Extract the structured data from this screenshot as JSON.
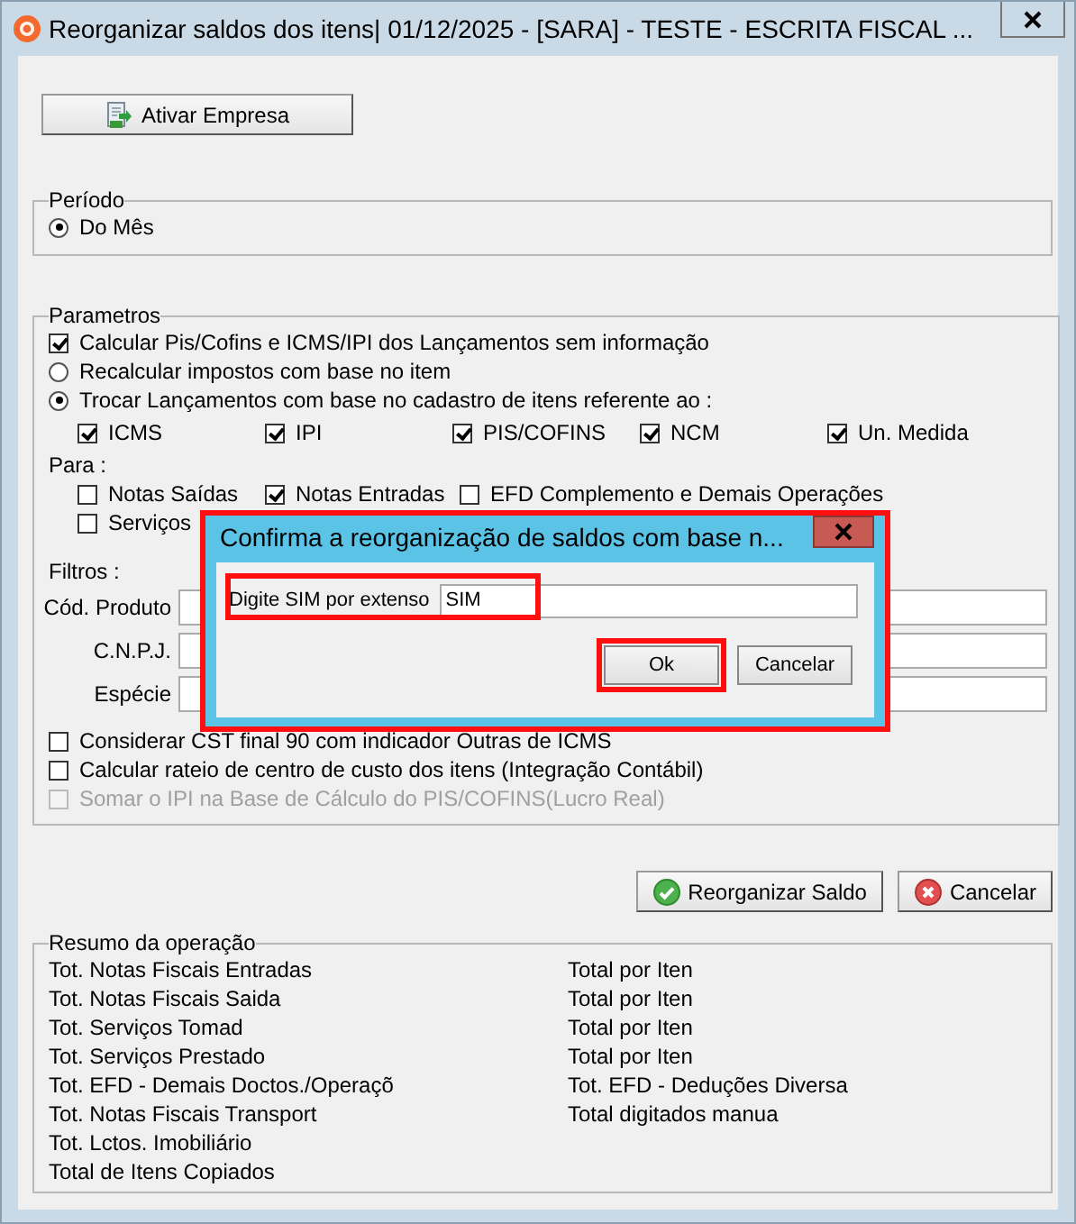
{
  "window": {
    "title": "Reorganizar saldos dos itens|  01/12/2025 - [SARA] - TESTE - ESCRITA FISCAL ..."
  },
  "toolbar": {
    "button": "Ativar Empresa"
  },
  "periodo": {
    "title": "Período",
    "options": [
      {
        "label": "Do Mês",
        "selected": true
      }
    ]
  },
  "parametros": {
    "title": "Parametros",
    "options": [
      {
        "kind": "checkbox",
        "label": "Calcular Pis/Cofins e ICMS/IPI dos Lançamentos sem informação",
        "checked": true
      },
      {
        "kind": "radio",
        "label": "Recalcular impostos com base no item",
        "checked": false
      },
      {
        "kind": "radio",
        "label": "Trocar Lançamentos com base no cadastro de itens referente ao :",
        "checked": true
      }
    ],
    "taxes": [
      {
        "label": "ICMS",
        "checked": true
      },
      {
        "label": "IPI",
        "checked": true
      },
      {
        "label": "PIS/COFINS",
        "checked": true
      },
      {
        "label": "NCM",
        "checked": true
      },
      {
        "label": "Un. Medida",
        "checked": true
      }
    ],
    "para_label": "Para :",
    "para": [
      {
        "label": "Notas Saídas",
        "checked": false
      },
      {
        "label": "Notas Entradas",
        "checked": true
      },
      {
        "label": "EFD Complemento e Demais Operações",
        "checked": false
      },
      {
        "label": "Serviços",
        "checked": false
      }
    ],
    "filtros_label": "Filtros :",
    "filters": [
      {
        "label": "Cód. Produto"
      },
      {
        "label": "C.N.P.J."
      },
      {
        "label": "Espécie"
      }
    ],
    "extra": [
      {
        "label": "Considerar CST final 90 com indicador Outras de ICMS",
        "checked": false,
        "disabled": false
      },
      {
        "label": "Calcular rateio de centro de custo dos itens   (Integração Contábil)",
        "checked": false,
        "disabled": false
      },
      {
        "label": "Somar o IPI na Base de Cálculo do PIS/COFINS(Lucro Real)",
        "checked": false,
        "disabled": true
      }
    ]
  },
  "actions": [
    {
      "kind": "confirm",
      "label": "Reorganizar Saldo"
    },
    {
      "kind": "cancel",
      "label": "Cancelar"
    }
  ],
  "resumo": {
    "title": "Resumo da operação",
    "left": [
      "Tot. Notas Fiscais Entradas",
      "Tot. Notas Fiscais Saida",
      "Tot. Serviços Tomad",
      "Tot. Serviços Prestado",
      "Tot. EFD - Demais Doctos./Operaçõ",
      "Tot. Notas Fiscais Transport",
      "Tot. Lctos. Imobiliário",
      "Total de Itens Copiados"
    ],
    "right": [
      "Total por Iten",
      "Total por Iten",
      "Total por Iten",
      "Total por Iten",
      "Tot. EFD - Deduções Diversa",
      "Total digitados manua"
    ]
  },
  "dialog": {
    "title": "Confirma a reorganização de saldos com base n...",
    "field_label": "Digite SIM por extenso",
    "value": "SIM",
    "buttons": [
      "Ok",
      "Cancelar"
    ]
  }
}
